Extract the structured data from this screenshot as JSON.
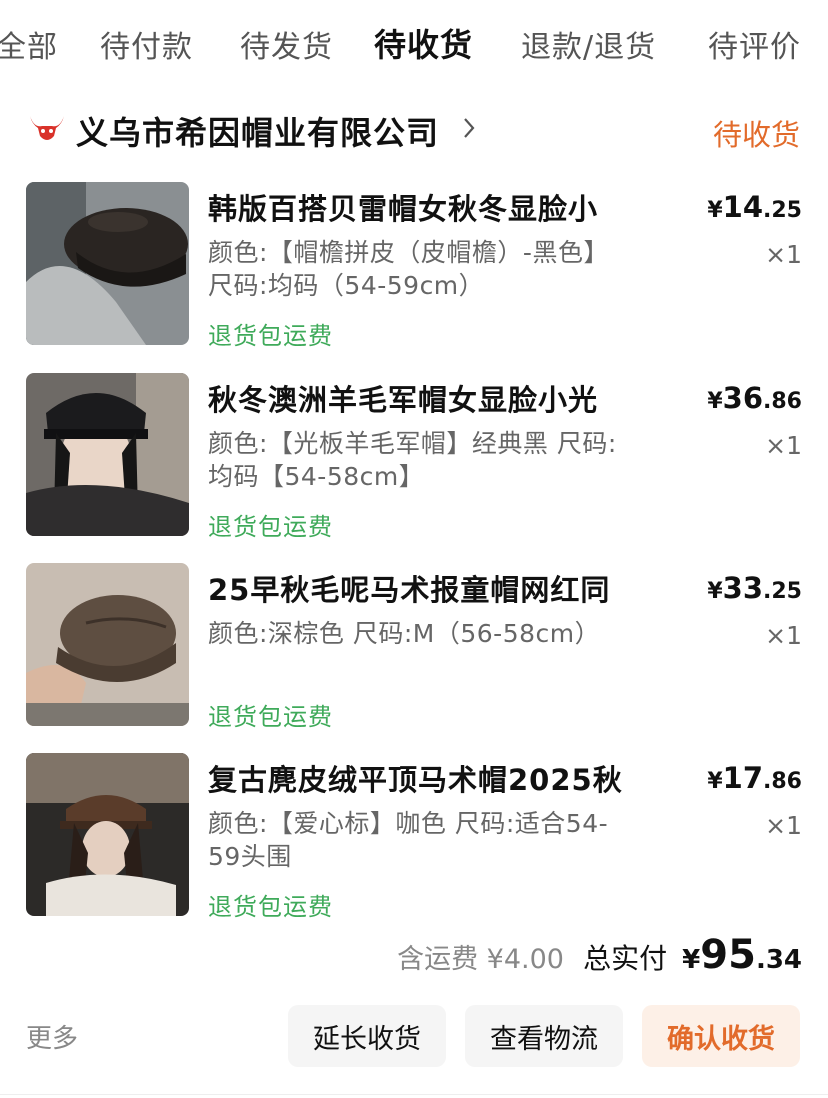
{
  "tabs": [
    "全部",
    "待付款",
    "待发货",
    "待收货",
    "退款/退货",
    "待评价"
  ],
  "shop": {
    "name": "义乌市希因帽业有限公司",
    "status": "待收货"
  },
  "items": [
    {
      "title": "韩版百搭贝雷帽女秋冬显脸小",
      "spec": "颜色:【帽檐拼皮（皮帽檐）-黑色】 尺码:均码（54-59cm）",
      "tag": "退货包运费",
      "price_yen": "¥",
      "price_int": "14",
      "price_dec": ".25",
      "qty": "×1"
    },
    {
      "title": "秋冬澳洲羊毛军帽女显脸小光",
      "spec": "颜色:【光板羊毛军帽】经典黑 尺码:均码【54-58cm】",
      "tag": "退货包运费",
      "price_yen": "¥",
      "price_int": "36",
      "price_dec": ".86",
      "qty": "×1"
    },
    {
      "title": "25早秋毛呢马术报童帽网红同",
      "spec": "颜色:深棕色 尺码:M（56-58cm）",
      "tag": "退货包运费",
      "price_yen": "¥",
      "price_int": "33",
      "price_dec": ".25",
      "qty": "×1"
    },
    {
      "title": "复古麂皮绒平顶马术帽2025秋",
      "spec": "颜色:【爱心标】咖色 尺码:适合54-59头围",
      "tag": "退货包运费",
      "price_yen": "¥",
      "price_int": "17",
      "price_dec": ".86",
      "qty": "×1"
    }
  ],
  "summary": {
    "shipping": "含运费 ¥4.00",
    "total_label": "总实付",
    "total_yen": "¥",
    "total_int": "95",
    "total_dec": ".34"
  },
  "actions": {
    "more": "更多",
    "extend": "延长收货",
    "logistics": "查看物流",
    "confirm": "确认收货"
  },
  "colors": {
    "accent": "#e26b2b",
    "tag_green": "#3faa5a",
    "shop_logo": "#d9322a"
  },
  "icons": {
    "shop_logo": "bull-head-icon",
    "chevron": "chevron-right-icon"
  }
}
